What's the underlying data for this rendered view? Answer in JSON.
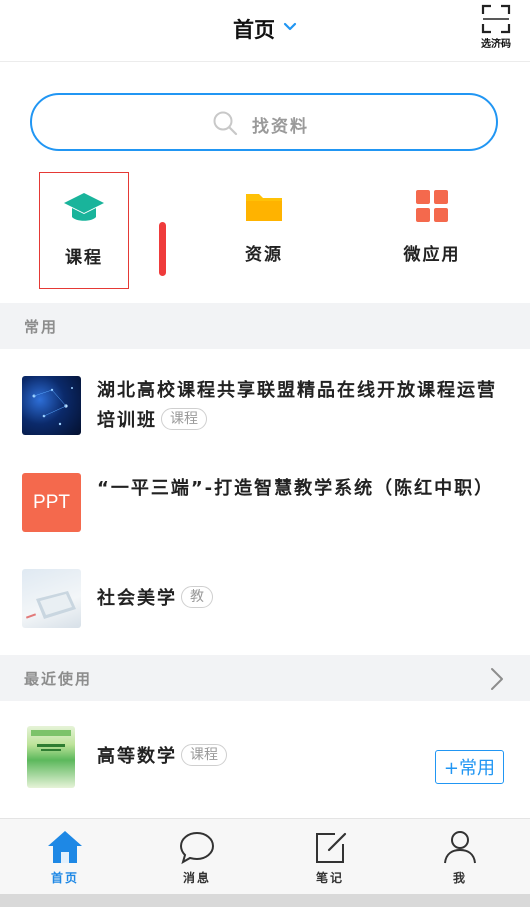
{
  "header": {
    "title": "首页",
    "scan_label": "选济码"
  },
  "search": {
    "placeholder": "找资料"
  },
  "quick_actions": [
    {
      "label": "课程",
      "icon": "graduation-cap-icon",
      "color": "#19b49b"
    },
    {
      "label": "资源",
      "icon": "folder-icon",
      "color": "#ffc107"
    },
    {
      "label": "微应用",
      "icon": "grid-apps-icon",
      "color": "#f4694d"
    }
  ],
  "sections": {
    "frequent": "常用",
    "recent": "最近使用"
  },
  "frequent_items": [
    {
      "title": "湖北高校课程共享联盟精品在线开放课程运营培训班",
      "tag": "课程",
      "thumb": "tech-blue-image"
    },
    {
      "title": "“一平三端”-打造智慧教学系统（陈红中职）",
      "tag": "",
      "thumb": "PPT"
    },
    {
      "title": "社会美学",
      "tag": "教",
      "thumb": "desk-laptop-image"
    }
  ],
  "recent_items": [
    {
      "title": "高等数学",
      "tag": "课程",
      "action": "+常用",
      "thumb": "textbook-cover-image"
    }
  ],
  "tabs": [
    {
      "label": "首页",
      "icon": "home-icon",
      "active": true
    },
    {
      "label": "消息",
      "icon": "message-bubble-icon",
      "active": false
    },
    {
      "label": "笔记",
      "icon": "note-edit-icon",
      "active": false
    },
    {
      "label": "我",
      "icon": "user-icon",
      "active": false
    }
  ],
  "colors": {
    "accent": "#2196f3",
    "active_tab": "#1e88e5",
    "highlight_border": "#e53935",
    "section_bg": "#f2f3f5"
  }
}
